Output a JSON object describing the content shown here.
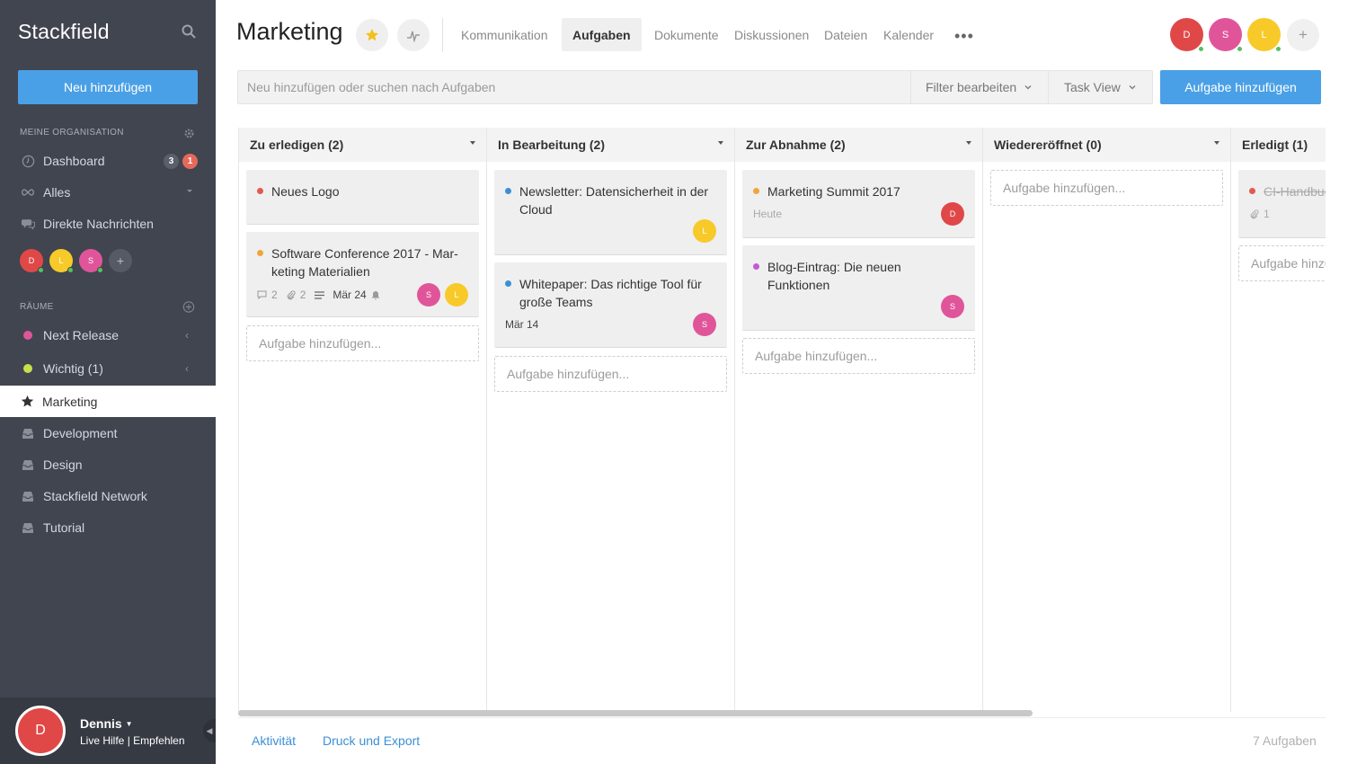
{
  "sidebar": {
    "brand": "Stackfield",
    "new_button": "Neu hinzufügen",
    "org_section": "Meine Organisation",
    "items": [
      {
        "label": "Dashboard",
        "badges": [
          "3",
          "1"
        ]
      },
      {
        "label": "Alles"
      },
      {
        "label": "Direkte Nachrichten"
      }
    ],
    "people": [
      {
        "initial": "D",
        "color": "#e04848"
      },
      {
        "initial": "L",
        "color": "#f7ca2a"
      },
      {
        "initial": "S",
        "color": "#e0559a"
      }
    ],
    "rooms_section": "Räume",
    "rooms": [
      {
        "label": "Next Release",
        "color": "#e0559a"
      },
      {
        "label": "Wichtig (1)",
        "color": "#c8e04a"
      },
      {
        "label": "Marketing",
        "active": true
      },
      {
        "label": "Development"
      },
      {
        "label": "Design"
      },
      {
        "label": "Stackfield Network"
      },
      {
        "label": "Tutorial"
      }
    ],
    "user": {
      "initial": "D",
      "name": "Dennis",
      "links": "Live Hilfe | Empfehlen"
    }
  },
  "header": {
    "title": "Marketing",
    "tabs": [
      "Kommunikation",
      "Aufgaben",
      "Dokumente",
      "Diskussionen",
      "Dateien",
      "Kalender"
    ],
    "active_tab": "Aufgaben",
    "members": [
      {
        "initial": "D",
        "color": "#e04848"
      },
      {
        "initial": "S",
        "color": "#e0559a"
      },
      {
        "initial": "L",
        "color": "#f7ca2a"
      }
    ],
    "add_member": "+"
  },
  "toolbar": {
    "search_placeholder": "Neu hinzufügen oder suchen nach Aufgaben",
    "filter_label": "Filter bearbeiten",
    "view_label": "Task View",
    "add_task_label": "Aufgabe hinzufügen"
  },
  "board": {
    "add_placeholder": "Aufgabe hinzufügen...",
    "columns": [
      {
        "title": "Zu erledigen (2)",
        "cards": [
          {
            "title": "Neues Logo",
            "dot": "#e05a4e"
          },
          {
            "title": "Software Conference 2017 - Mar-keting Materialien",
            "dot": "#f0a53a",
            "comments": "2",
            "attachments": "2",
            "date": "Mär 24",
            "assignees": [
              "S",
              "L"
            ]
          }
        ]
      },
      {
        "title": "In Bearbeitung (2)",
        "cards": [
          {
            "title": "Newsletter: Datensicherheit in der Cloud",
            "dot": "#3b8fd6",
            "assignees": [
              "L"
            ]
          },
          {
            "title": "Whitepaper: Das richtige Tool für große Teams",
            "dot": "#3b8fd6",
            "date": "Mär 14",
            "assignees": [
              "S"
            ]
          }
        ]
      },
      {
        "title": "Zur Abnahme (2)",
        "cards": [
          {
            "title": "Marketing Summit 2017",
            "dot": "#f0a53a",
            "date": "Heute",
            "assignees": [
              "D"
            ]
          },
          {
            "title": "Blog-Eintrag: Die neuen Funktionen",
            "dot": "#c45ad6",
            "assignees": [
              "S"
            ]
          }
        ]
      },
      {
        "title": "Wiedereröffnet (0)",
        "cards": []
      },
      {
        "title": "Erledigt (1)",
        "cards": [
          {
            "title": "CI-Handbuch",
            "dot": "#e05a4e",
            "attachments": "1",
            "done": true
          }
        ]
      }
    ]
  },
  "footer": {
    "activity": "Aktivität",
    "export": "Druck und Export",
    "count": "7 Aufgaben"
  }
}
